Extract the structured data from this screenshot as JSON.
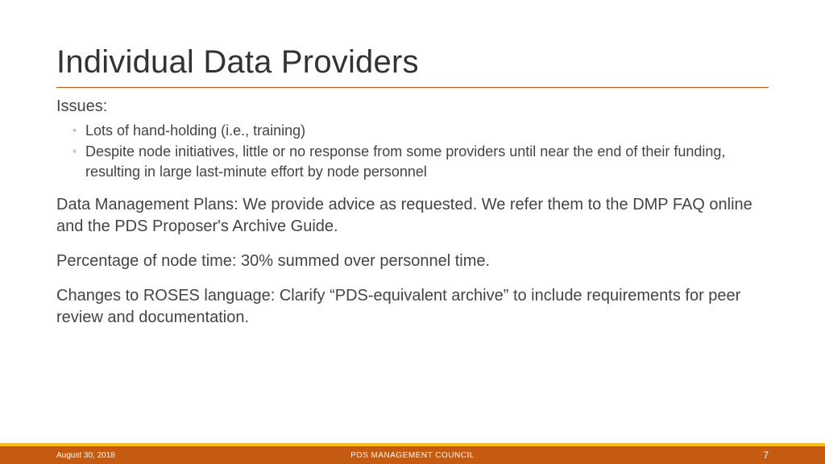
{
  "title": "Individual Data Providers",
  "issues_label": "Issues:",
  "issues": [
    "Lots of hand-holding (i.e., training)",
    "Despite node initiatives, little or no response from some providers until near the end of their funding, resulting in large last-minute effort by node personnel"
  ],
  "paragraphs": [
    "Data Management Plans: We provide advice as requested. We refer them to the DMP FAQ online and the PDS Proposer's Archive Guide.",
    "Percentage of node time: 30% summed over personnel time.",
    "Changes to ROSES language: Clarify “PDS-equivalent archive” to include requirements for peer review and documentation."
  ],
  "footer": {
    "date": "August 30, 2018",
    "center": "PDS MANAGEMENT COUNCIL",
    "page": "7"
  }
}
